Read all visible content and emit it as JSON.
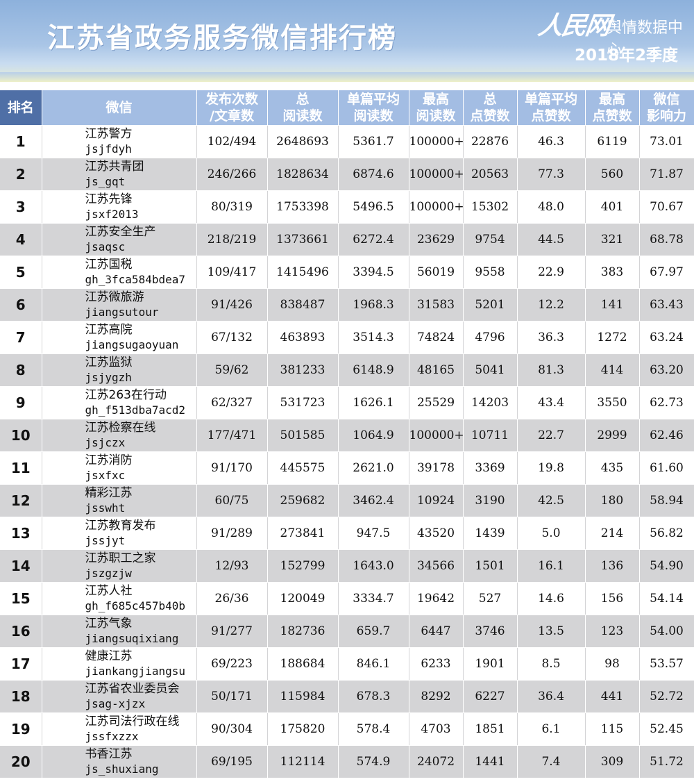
{
  "header": {
    "title": "江苏省政务服务微信排行榜",
    "logo_script": "人民网",
    "logo_sub": "舆情数据中心",
    "quarter": "2018年2季度"
  },
  "columns": [
    {
      "l1": "排名",
      "l2": ""
    },
    {
      "l1": "微信",
      "l2": ""
    },
    {
      "l1": "发布次数",
      "l2": "/文章数"
    },
    {
      "l1": "总",
      "l2": "阅读数"
    },
    {
      "l1": "单篇平均",
      "l2": "阅读数"
    },
    {
      "l1": "最高",
      "l2": "阅读数"
    },
    {
      "l1": "总",
      "l2": "点赞数"
    },
    {
      "l1": "单篇平均",
      "l2": "点赞数"
    },
    {
      "l1": "最高",
      "l2": "点赞数"
    },
    {
      "l1": "微信",
      "l2": "影响力"
    }
  ],
  "rows": [
    {
      "rank": "1",
      "name": "江苏警方",
      "id": "jsjfdyh",
      "posts": "102/494",
      "total_read": "2648693",
      "avg_read": "5361.7",
      "max_read": "100000+",
      "total_like": "22876",
      "avg_like": "46.3",
      "max_like": "6119",
      "influence": "73.01"
    },
    {
      "rank": "2",
      "name": "江苏共青团",
      "id": "js_gqt",
      "posts": "246/266",
      "total_read": "1828634",
      "avg_read": "6874.6",
      "max_read": "100000+",
      "total_like": "20563",
      "avg_like": "77.3",
      "max_like": "560",
      "influence": "71.87"
    },
    {
      "rank": "3",
      "name": "江苏先锋",
      "id": "jsxf2013",
      "posts": "80/319",
      "total_read": "1753398",
      "avg_read": "5496.5",
      "max_read": "100000+",
      "total_like": "15302",
      "avg_like": "48.0",
      "max_like": "401",
      "influence": "70.67"
    },
    {
      "rank": "4",
      "name": "江苏安全生产",
      "id": "jsaqsc",
      "posts": "218/219",
      "total_read": "1373661",
      "avg_read": "6272.4",
      "max_read": "23629",
      "total_like": "9754",
      "avg_like": "44.5",
      "max_like": "321",
      "influence": "68.78"
    },
    {
      "rank": "5",
      "name": "江苏国税",
      "id": "gh_3fca584bdea7",
      "posts": "109/417",
      "total_read": "1415496",
      "avg_read": "3394.5",
      "max_read": "56019",
      "total_like": "9558",
      "avg_like": "22.9",
      "max_like": "383",
      "influence": "67.97"
    },
    {
      "rank": "6",
      "name": "江苏微旅游",
      "id": "jiangsutour",
      "posts": "91/426",
      "total_read": "838487",
      "avg_read": "1968.3",
      "max_read": "31583",
      "total_like": "5201",
      "avg_like": "12.2",
      "max_like": "141",
      "influence": "63.43"
    },
    {
      "rank": "7",
      "name": "江苏高院",
      "id": "jiangsugaoyuan",
      "posts": "67/132",
      "total_read": "463893",
      "avg_read": "3514.3",
      "max_read": "74824",
      "total_like": "4796",
      "avg_like": "36.3",
      "max_like": "1272",
      "influence": "63.24"
    },
    {
      "rank": "8",
      "name": "江苏监狱",
      "id": "jsjygzh",
      "posts": "59/62",
      "total_read": "381233",
      "avg_read": "6148.9",
      "max_read": "48165",
      "total_like": "5041",
      "avg_like": "81.3",
      "max_like": "414",
      "influence": "63.20"
    },
    {
      "rank": "9",
      "name": "江苏263在行动",
      "id": "gh_f513dba7acd2",
      "posts": "62/327",
      "total_read": "531723",
      "avg_read": "1626.1",
      "max_read": "25529",
      "total_like": "14203",
      "avg_like": "43.4",
      "max_like": "3550",
      "influence": "62.73"
    },
    {
      "rank": "10",
      "name": "江苏检察在线",
      "id": "jsjczx",
      "posts": "177/471",
      "total_read": "501585",
      "avg_read": "1064.9",
      "max_read": "100000+",
      "total_like": "10711",
      "avg_like": "22.7",
      "max_like": "2999",
      "influence": "62.46"
    },
    {
      "rank": "11",
      "name": "江苏消防",
      "id": "jsxfxc",
      "posts": "91/170",
      "total_read": "445575",
      "avg_read": "2621.0",
      "max_read": "39178",
      "total_like": "3369",
      "avg_like": "19.8",
      "max_like": "435",
      "influence": "61.60"
    },
    {
      "rank": "12",
      "name": "精彩江苏",
      "id": "jsswht",
      "posts": "60/75",
      "total_read": "259682",
      "avg_read": "3462.4",
      "max_read": "10924",
      "total_like": "3190",
      "avg_like": "42.5",
      "max_like": "180",
      "influence": "58.94"
    },
    {
      "rank": "13",
      "name": "江苏教育发布",
      "id": "jssjyt",
      "posts": "91/289",
      "total_read": "273841",
      "avg_read": "947.5",
      "max_read": "43520",
      "total_like": "1439",
      "avg_like": "5.0",
      "max_like": "214",
      "influence": "56.82"
    },
    {
      "rank": "14",
      "name": "江苏职工之家",
      "id": "jszgzjw",
      "posts": "12/93",
      "total_read": "152799",
      "avg_read": "1643.0",
      "max_read": "34566",
      "total_like": "1501",
      "avg_like": "16.1",
      "max_like": "136",
      "influence": "54.90"
    },
    {
      "rank": "15",
      "name": "江苏人社",
      "id": "gh_f685c457b40b",
      "posts": "26/36",
      "total_read": "120049",
      "avg_read": "3334.7",
      "max_read": "19642",
      "total_like": "527",
      "avg_like": "14.6",
      "max_like": "156",
      "influence": "54.14"
    },
    {
      "rank": "16",
      "name": "江苏气象",
      "id": "jiangsuqixiang",
      "posts": "91/277",
      "total_read": "182736",
      "avg_read": "659.7",
      "max_read": "6447",
      "total_like": "3746",
      "avg_like": "13.5",
      "max_like": "123",
      "influence": "54.00"
    },
    {
      "rank": "17",
      "name": "健康江苏",
      "id": "jiankangjiangsu",
      "posts": "69/223",
      "total_read": "188684",
      "avg_read": "846.1",
      "max_read": "6233",
      "total_like": "1901",
      "avg_like": "8.5",
      "max_like": "98",
      "influence": "53.57"
    },
    {
      "rank": "18",
      "name": "江苏省农业委员会",
      "id": "jsag-xjzx",
      "posts": "50/171",
      "total_read": "115984",
      "avg_read": "678.3",
      "max_read": "8292",
      "total_like": "6227",
      "avg_like": "36.4",
      "max_like": "441",
      "influence": "52.72"
    },
    {
      "rank": "19",
      "name": "江苏司法行政在线",
      "id": "jssfxzzx",
      "posts": "90/304",
      "total_read": "175820",
      "avg_read": "578.4",
      "max_read": "4703",
      "total_like": "1851",
      "avg_like": "6.1",
      "max_like": "115",
      "influence": "52.45"
    },
    {
      "rank": "20",
      "name": "书香江苏",
      "id": "js_shuxiang",
      "posts": "69/195",
      "total_read": "112114",
      "avg_read": "574.9",
      "max_read": "24072",
      "total_like": "1441",
      "avg_like": "7.4",
      "max_like": "309",
      "influence": "51.72"
    }
  ],
  "colors": {
    "header_bg": "#a3bde3",
    "rank_header_bg": "#4f6fa6",
    "stripe": "#d4d4d6"
  }
}
